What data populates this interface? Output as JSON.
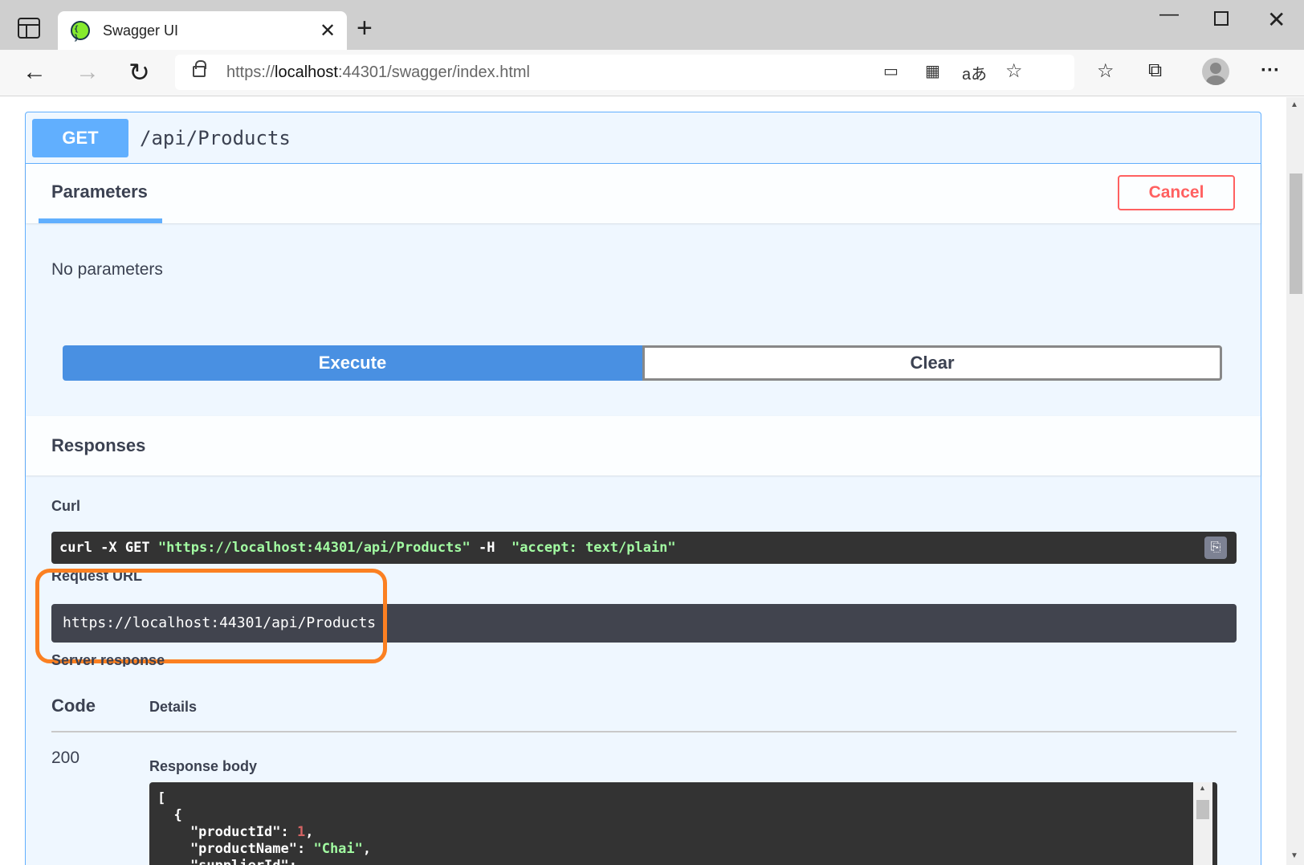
{
  "browser": {
    "tab_title": "Swagger UI",
    "tab_close": "✕",
    "new_tab": "+",
    "url_scheme": "https://",
    "url_host": "localhost",
    "url_rest": ":44301/swagger/index.html",
    "window_controls": {
      "minimize": "—",
      "close": "✕"
    },
    "nav": {
      "back": "←",
      "forward": "→",
      "reload": "↻"
    },
    "url_icons": {
      "app_available": "▭",
      "qr": "▦",
      "read_aloud": "aあ",
      "add_favorite": "☆"
    },
    "toolbar": {
      "favorites": "☆",
      "collections": "⧉",
      "menu": "···"
    }
  },
  "operation": {
    "method": "GET",
    "path": "/api/Products",
    "method_color": "#61affe"
  },
  "parameters": {
    "tab_label": "Parameters",
    "cancel_label": "Cancel",
    "empty_text": "No parameters"
  },
  "actions": {
    "execute_label": "Execute",
    "clear_label": "Clear"
  },
  "responses": {
    "title": "Responses",
    "curl_label": "Curl",
    "curl_prefix": "curl -X GET ",
    "curl_url": "\"https://localhost:44301/api/Products\"",
    "curl_mid": " -H  ",
    "curl_header": "\"accept: text/plain\"",
    "request_url_label": "Request URL",
    "request_url": "https://localhost:44301/api/Products",
    "server_response_label": "Server response",
    "code_header": "Code",
    "details_header": "Details",
    "code": "200",
    "response_body_label": "Response body",
    "body_lines": {
      "l1": "[",
      "l2": "  {",
      "l3_key": "    \"productId\": ",
      "l3_val": "1",
      "l3_end": ",",
      "l4_key": "    \"productName\": ",
      "l4_val": "\"Chai\"",
      "l4_end": ",",
      "l5": "    \"supplierId\":"
    }
  },
  "colors": {
    "highlight": "#fb8022",
    "execute": "#4990e2",
    "cancel": "#ff6060"
  }
}
